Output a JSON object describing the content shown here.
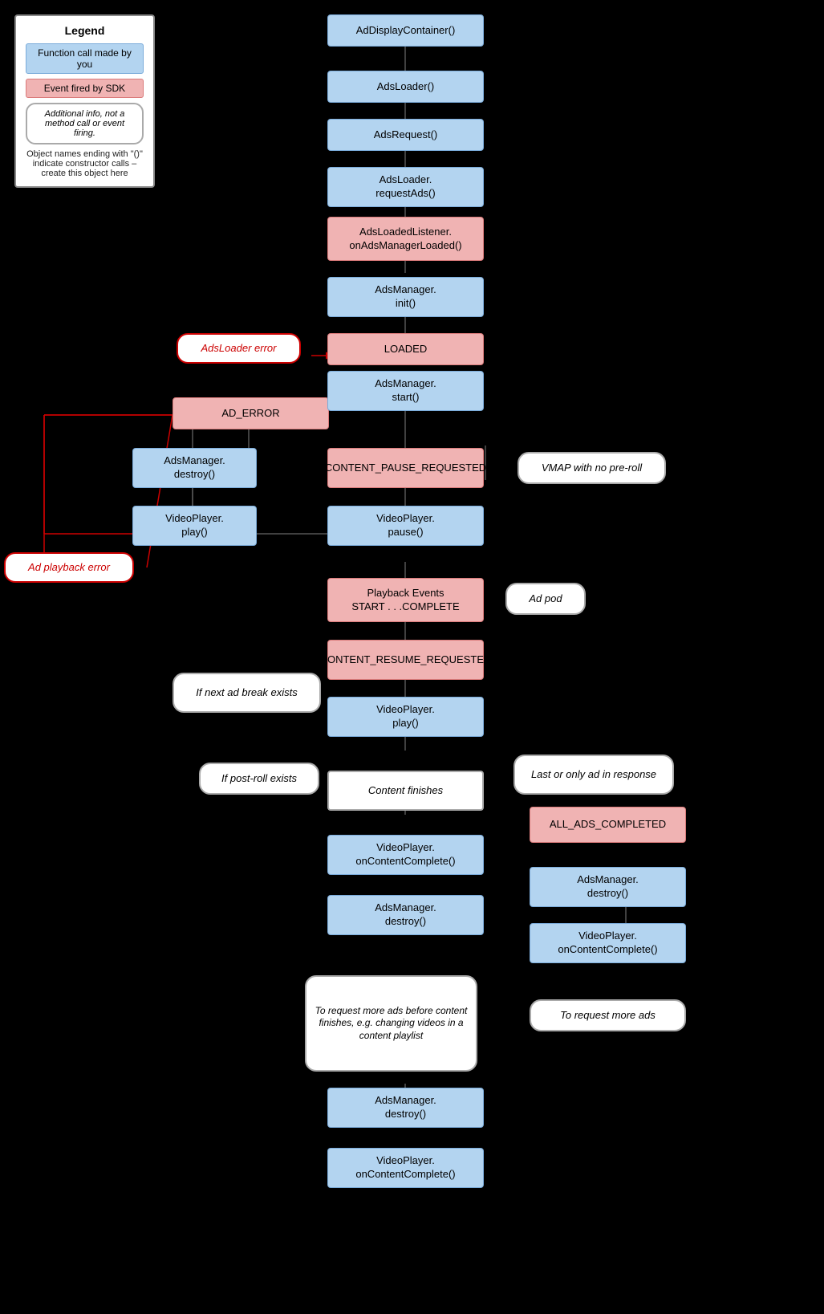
{
  "legend": {
    "title": "Legend",
    "blue_label": "Function call made by you",
    "pink_label": "Event fired by SDK",
    "italic_label": "Additional info, not a method call or event firing.",
    "note": "Object names ending with \"()\" indicate constructor calls – create this object here"
  },
  "boxes": {
    "ad_display_container": "AdDisplayContainer()",
    "ads_loader": "AdsLoader()",
    "ads_request": "AdsRequest()",
    "ads_loader_request_ads": "AdsLoader.\nrequestAds()",
    "ads_loaded_listener": "AdsLoadedListener.\nonAdsManagerLoaded()",
    "ads_manager_init": "AdsManager.\ninit()",
    "adsloader_error": "AdsLoader error",
    "loaded": "LOADED",
    "ad_error": "AD_ERROR",
    "ads_manager_start": "AdsManager.\nstart()",
    "ad_playback_error": "Ad playback error",
    "ads_manager_destroy": "AdsManager.\ndestroy()",
    "content_pause_requested": "CONTENT_PAUSE_REQUESTED",
    "vmap_no_preroll": "VMAP with no pre-roll",
    "video_player_play_top": "VideoPlayer.\nplay()",
    "video_player_pause": "VideoPlayer.\npause()",
    "playback_events": "Playback Events\nSTART . . .COMPLETE",
    "ad_pod": "Ad pod",
    "if_next_ad_break": "If next ad break exists",
    "content_resume_requested": "CONTENT_RESUME_REQUESTED",
    "video_player_play_mid": "VideoPlayer.\nplay()",
    "if_post_roll": "If post-roll exists",
    "last_only_ad": "Last or only ad in response",
    "content_finishes": "Content finishes",
    "all_ads_completed": "ALL_ADS_COMPLETED",
    "video_player_oncontent_complete": "VideoPlayer.\nonContentComplete()",
    "ads_manager_destroy2": "AdsManager.\ndestroy()",
    "video_player_oncontent_complete2": "VideoPlayer.\nonContentComplete()",
    "to_request_more_ads": "To request more ads before content finishes, e.g. changing videos in a content playlist",
    "to_request_more_ads_label": "To request more ads",
    "ads_manager_destroy3": "AdsManager.\ndestroy()",
    "video_player_oncontent_complete3": "VideoPlayer.\nonContentComplete()"
  }
}
